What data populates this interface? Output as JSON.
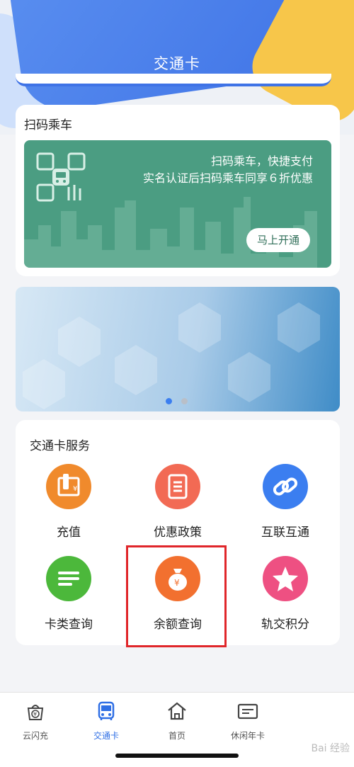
{
  "header": {
    "title": "交通卡"
  },
  "scan": {
    "section_title": "扫码乘车",
    "line1": "扫码乘车，快捷支付",
    "line2": "实名认证后扫码乘车同享６折优惠",
    "button": "马上开通"
  },
  "carousel": {
    "page_count": 2,
    "active_index": 0
  },
  "services": {
    "section_title": "交通卡服务",
    "items": [
      {
        "label": "充值",
        "icon": "recharge-card-icon",
        "color": "#f08a2c"
      },
      {
        "label": "优惠政策",
        "icon": "document-icon",
        "color": "#f26a54"
      },
      {
        "label": "互联互通",
        "icon": "link-icon",
        "color": "#3b7ef0"
      },
      {
        "label": "卡类查询",
        "icon": "list-icon",
        "color": "#4cb83b"
      },
      {
        "label": "余额查询",
        "icon": "money-bag-icon",
        "color": "#f2702f"
      },
      {
        "label": "轨交积分",
        "icon": "star-icon",
        "color": "#ee5082"
      }
    ]
  },
  "tabbar": {
    "tabs": [
      {
        "label": "云闪充",
        "icon": "yuan-bag-icon"
      },
      {
        "label": "交通卡",
        "icon": "bus-icon",
        "active": true
      },
      {
        "label": "首页",
        "icon": "home-icon"
      },
      {
        "label": "休闲年卡",
        "icon": "card-icon"
      }
    ]
  },
  "colors": {
    "accent": "#2f6fe5",
    "scan_banner": "#4b9d82",
    "highlight_box": "#e0262a"
  },
  "watermark": "Bai 经验"
}
